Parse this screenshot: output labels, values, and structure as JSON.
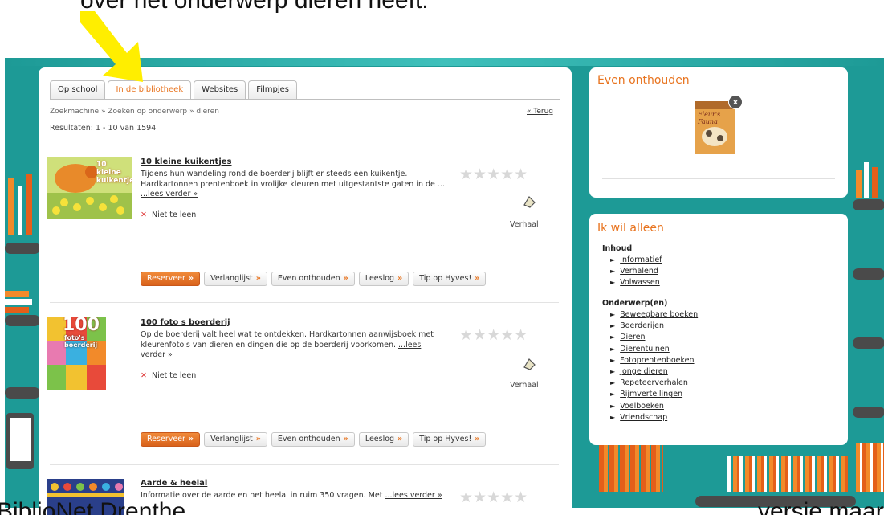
{
  "slide": {
    "top_text": "over het onderwerp dieren heeft.",
    "bottom_left_text": "BiblioNet Drenthe",
    "bottom_right_text": "versie maart"
  },
  "tabs": [
    {
      "label": "Op school"
    },
    {
      "label": "In de bibliotheek"
    },
    {
      "label": "Websites"
    },
    {
      "label": "Filmpjes"
    }
  ],
  "breadcrumb": {
    "items": [
      "Zoekmachine",
      "Zoeken op onderwerp",
      "dieren"
    ],
    "separator": "»"
  },
  "back_link": "« Terug",
  "results_text": "Resultaten: 1 - 10 van 1594",
  "items": [
    {
      "title": "10 kleine kuikentjes",
      "description": "Tijdens hun wandeling rond de boerderij blijft er steeds één kuikentje. Hardkartonnen prentenboek in vrolijke kleuren met uitgestantste gaten in de ...",
      "more": "...lees verder »",
      "availability": "Niet te leen",
      "genre": "Verhaal",
      "cover_text": "10 kleine kuikentjes"
    },
    {
      "title": "100 foto s boerderij",
      "description": "Op de boerderij valt heel wat te ontdekken. Hardkartonnen aanwijsboek met kleurenfoto's van dieren en dingen die op de boerderij voorkomen.",
      "more": "...lees verder »",
      "availability": "Niet te leen",
      "genre": "Verhaal",
      "cover_number": "100",
      "cover_text": "foto's boerderij"
    },
    {
      "title": "Aarde & heelal",
      "description": "Informatie over de aarde en het heelal in ruim 350 vragen. Met ",
      "more": "...lees verder »"
    }
  ],
  "buttons": {
    "reserve": "Reserveer",
    "wishlist": "Verlanglijst",
    "remember": "Even onthouden",
    "readlog": "Leeslog",
    "hyves": "Tip op Hyves!"
  },
  "remember_panel": {
    "title": "Even onthouden",
    "close_label": "x",
    "thumb_title": "Fleur's Fauna"
  },
  "filter_panel": {
    "title": "Ik wil alleen",
    "sections": [
      {
        "heading": "Inhoud",
        "items": [
          "Informatief",
          "Verhalend",
          "Volwassen"
        ]
      },
      {
        "heading": "Onderwerp(en)",
        "items": [
          "Beweegbare boeken",
          "Boerderijen",
          "Dieren",
          "Dierentuinen",
          "Fotoprentenboeken",
          "Jonge dieren",
          "Repeteerverhalen",
          "Rijmvertellingen",
          "Voelboeken",
          "Vriendschap"
        ]
      }
    ]
  },
  "colors": {
    "accent": "#e8731e",
    "teal": "#1d9a96",
    "arrow": "#ffee00"
  }
}
